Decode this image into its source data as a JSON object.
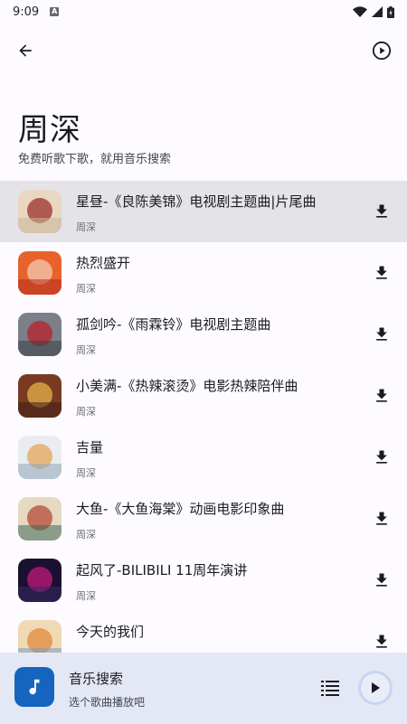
{
  "status_bar": {
    "time": "9:09",
    "notification_icon": "a-icon",
    "icons": [
      "wifi-icon",
      "signal-icon",
      "battery-icon"
    ]
  },
  "top_bar": {
    "back_icon": "arrow-back-icon",
    "action_icon": "play-circle-icon"
  },
  "header": {
    "title": "周深",
    "subtitle": "免费听歌下歌，就用音乐搜索"
  },
  "songs": [
    {
      "title": "星昼-《良陈美锦》电视剧主题曲|片尾曲",
      "artist": "周深",
      "selected": true,
      "cover_colors": [
        "#E8D7C2",
        "#9C2F2A",
        "#C8B49A"
      ]
    },
    {
      "title": "热烈盛开",
      "artist": "周深",
      "selected": false,
      "cover_colors": [
        "#E8622C",
        "#F4C9B4",
        "#B22E1E"
      ]
    },
    {
      "title": "孤剑吟-《雨霖铃》电视剧主题曲",
      "artist": "周深",
      "selected": false,
      "cover_colors": [
        "#7A7F88",
        "#B8222B",
        "#3A3E46"
      ]
    },
    {
      "title": "小美满-《热辣滚烫》电影热辣陪伴曲",
      "artist": "周深",
      "selected": false,
      "cover_colors": [
        "#7A3A22",
        "#E6B24A",
        "#3C1E14"
      ]
    },
    {
      "title": "吉量",
      "artist": "周深",
      "selected": false,
      "cover_colors": [
        "#E9EDF1",
        "#E4A65B",
        "#8FA6B8"
      ]
    },
    {
      "title": "大鱼-《大鱼海棠》动画电影印象曲",
      "artist": "周深",
      "selected": false,
      "cover_colors": [
        "#E6D9C4",
        "#B54A3A",
        "#3F6B58"
      ]
    },
    {
      "title": "起风了-BILIBILI 11周年演讲",
      "artist": "周深",
      "selected": false,
      "cover_colors": [
        "#1A1030",
        "#C2187A",
        "#3A2A66"
      ]
    },
    {
      "title": "今天的我们",
      "artist": "周深",
      "selected": false,
      "cover_colors": [
        "#F0D9B5",
        "#E08A3C",
        "#7E9CC0"
      ]
    }
  ],
  "download_icon": "download-icon",
  "player": {
    "title": "音乐搜索",
    "subtitle": "选个歌曲播放吧",
    "icon": "music-note-icon",
    "playlist_icon": "playlist-icon",
    "play_icon": "play-icon"
  },
  "colors": {
    "accent": "#1565C0",
    "player_bg": "#E4E8F4",
    "selected_row": "#E3E3E8",
    "background": "#FDFBFF"
  }
}
